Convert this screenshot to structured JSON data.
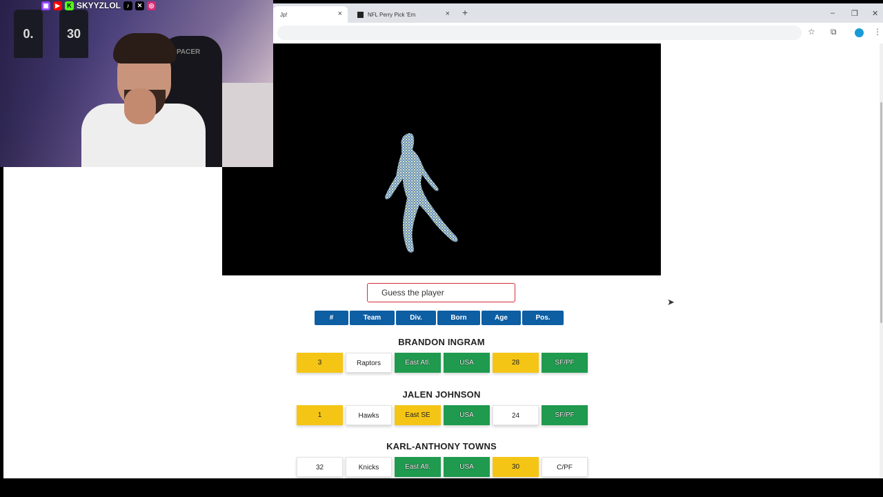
{
  "browser": {
    "tabs": [
      {
        "label": "Jp!",
        "close": "×"
      },
      {
        "label": "NFL Perry Pick 'Em",
        "close": "×"
      }
    ],
    "new_tab": "+",
    "window_controls": {
      "minimize": "–",
      "restore": "❐",
      "close": "✕"
    },
    "toolbar_icons": {
      "bookmark": "☆",
      "extensions": "⧉",
      "menu": "⋮"
    }
  },
  "stream_overlay": {
    "handle": "SKYYZLOL",
    "jersey_numbers": [
      "0.",
      "30"
    ],
    "chair_text": "PACER"
  },
  "game": {
    "guess_placeholder": "Guess the player",
    "headers": [
      "#",
      "Team",
      "Div.",
      "Born",
      "Age",
      "Pos."
    ],
    "guesses": [
      {
        "name": "BRANDON INGRAM",
        "cells": [
          {
            "value": "3",
            "status": "yellow"
          },
          {
            "value": "Raptors",
            "status": "white"
          },
          {
            "value": "East Atl.",
            "status": "green"
          },
          {
            "value": "USA",
            "status": "green"
          },
          {
            "value": "28",
            "status": "yellow"
          },
          {
            "value": "SF/PF",
            "status": "green"
          }
        ]
      },
      {
        "name": "JALEN JOHNSON",
        "cells": [
          {
            "value": "1",
            "status": "yellow"
          },
          {
            "value": "Hawks",
            "status": "white"
          },
          {
            "value": "East SE",
            "status": "yellow"
          },
          {
            "value": "USA",
            "status": "green"
          },
          {
            "value": "24",
            "status": "white"
          },
          {
            "value": "SF/PF",
            "status": "green"
          }
        ]
      },
      {
        "name": "KARL-ANTHONY TOWNS",
        "cells": [
          {
            "value": "32",
            "status": "white"
          },
          {
            "value": "Knicks",
            "status": "white"
          },
          {
            "value": "East Atl.",
            "status": "green"
          },
          {
            "value": "USA",
            "status": "green"
          },
          {
            "value": "30",
            "status": "yellow"
          },
          {
            "value": "C/PF",
            "status": "white"
          }
        ]
      }
    ]
  },
  "colors": {
    "header_blue": "#0d5ea3",
    "match_green": "#1f9a4e",
    "partial_yellow": "#f5c515",
    "input_border_red": "#d32a3a"
  }
}
